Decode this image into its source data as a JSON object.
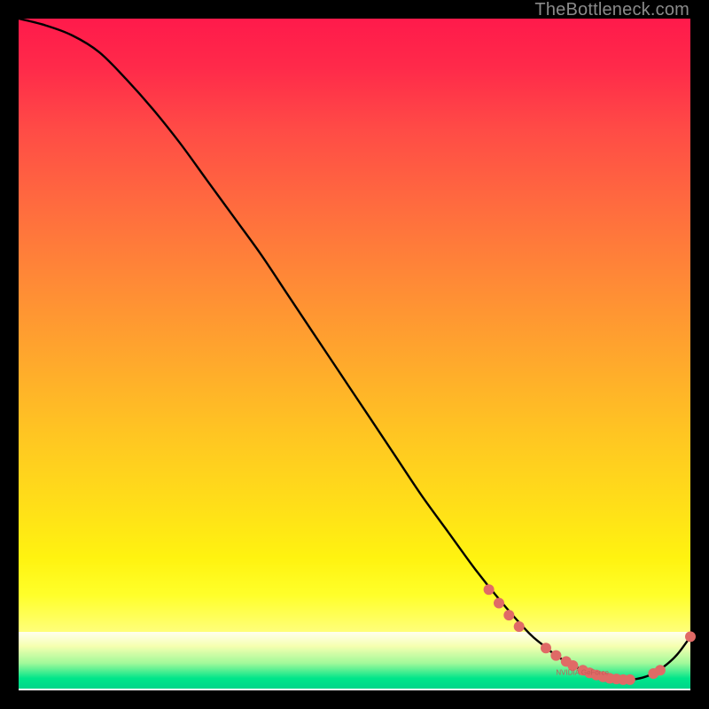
{
  "watermark": "TheBottleneck.com",
  "colors": {
    "bg": "#000000",
    "line": "#000000",
    "marker": "#e06a66",
    "gradient_top": "#ff1a4b",
    "gradient_mid": "#ffe018",
    "gradient_green": "#00e58a"
  },
  "chart_data": {
    "type": "line",
    "title": "",
    "xlabel": "",
    "ylabel": "",
    "xlim": [
      0,
      100
    ],
    "ylim": [
      0,
      100
    ],
    "grid": false,
    "legend": false,
    "series": [
      {
        "name": "bottleneck-curve",
        "x": [
          0,
          4,
          8,
          12,
          16,
          20,
          24,
          28,
          32,
          36,
          40,
          44,
          48,
          52,
          56,
          60,
          64,
          68,
          72,
          76,
          78,
          80,
          82,
          84,
          86,
          88,
          90,
          92,
          94,
          96,
          98,
          100
        ],
        "y": [
          100,
          99,
          97.5,
          95,
          91,
          86.5,
          81.5,
          76,
          70.5,
          65,
          59,
          53,
          47,
          41,
          35,
          29,
          23.5,
          18,
          13,
          8.5,
          6.8,
          5.2,
          4,
          3,
          2.3,
          1.8,
          1.6,
          1.7,
          2.3,
          3.5,
          5.3,
          8
        ]
      }
    ],
    "markers": [
      {
        "x": 70.0,
        "y": 15.0
      },
      {
        "x": 71.5,
        "y": 13.0
      },
      {
        "x": 73.0,
        "y": 11.2
      },
      {
        "x": 74.5,
        "y": 9.5
      },
      {
        "x": 78.5,
        "y": 6.3
      },
      {
        "x": 80.0,
        "y": 5.2
      },
      {
        "x": 81.5,
        "y": 4.3
      },
      {
        "x": 82.5,
        "y": 3.7
      },
      {
        "x": 84.0,
        "y": 3.0
      },
      {
        "x": 85.0,
        "y": 2.6
      },
      {
        "x": 86.0,
        "y": 2.3
      },
      {
        "x": 87.0,
        "y": 2.0
      },
      {
        "x": 88.0,
        "y": 1.8
      },
      {
        "x": 89.0,
        "y": 1.7
      },
      {
        "x": 90.0,
        "y": 1.6
      },
      {
        "x": 91.0,
        "y": 1.6
      },
      {
        "x": 94.5,
        "y": 2.5
      },
      {
        "x": 95.5,
        "y": 3.0
      },
      {
        "x": 100.0,
        "y": 8.0
      }
    ],
    "small_marker_label": "NVIDIA GeForce"
  }
}
